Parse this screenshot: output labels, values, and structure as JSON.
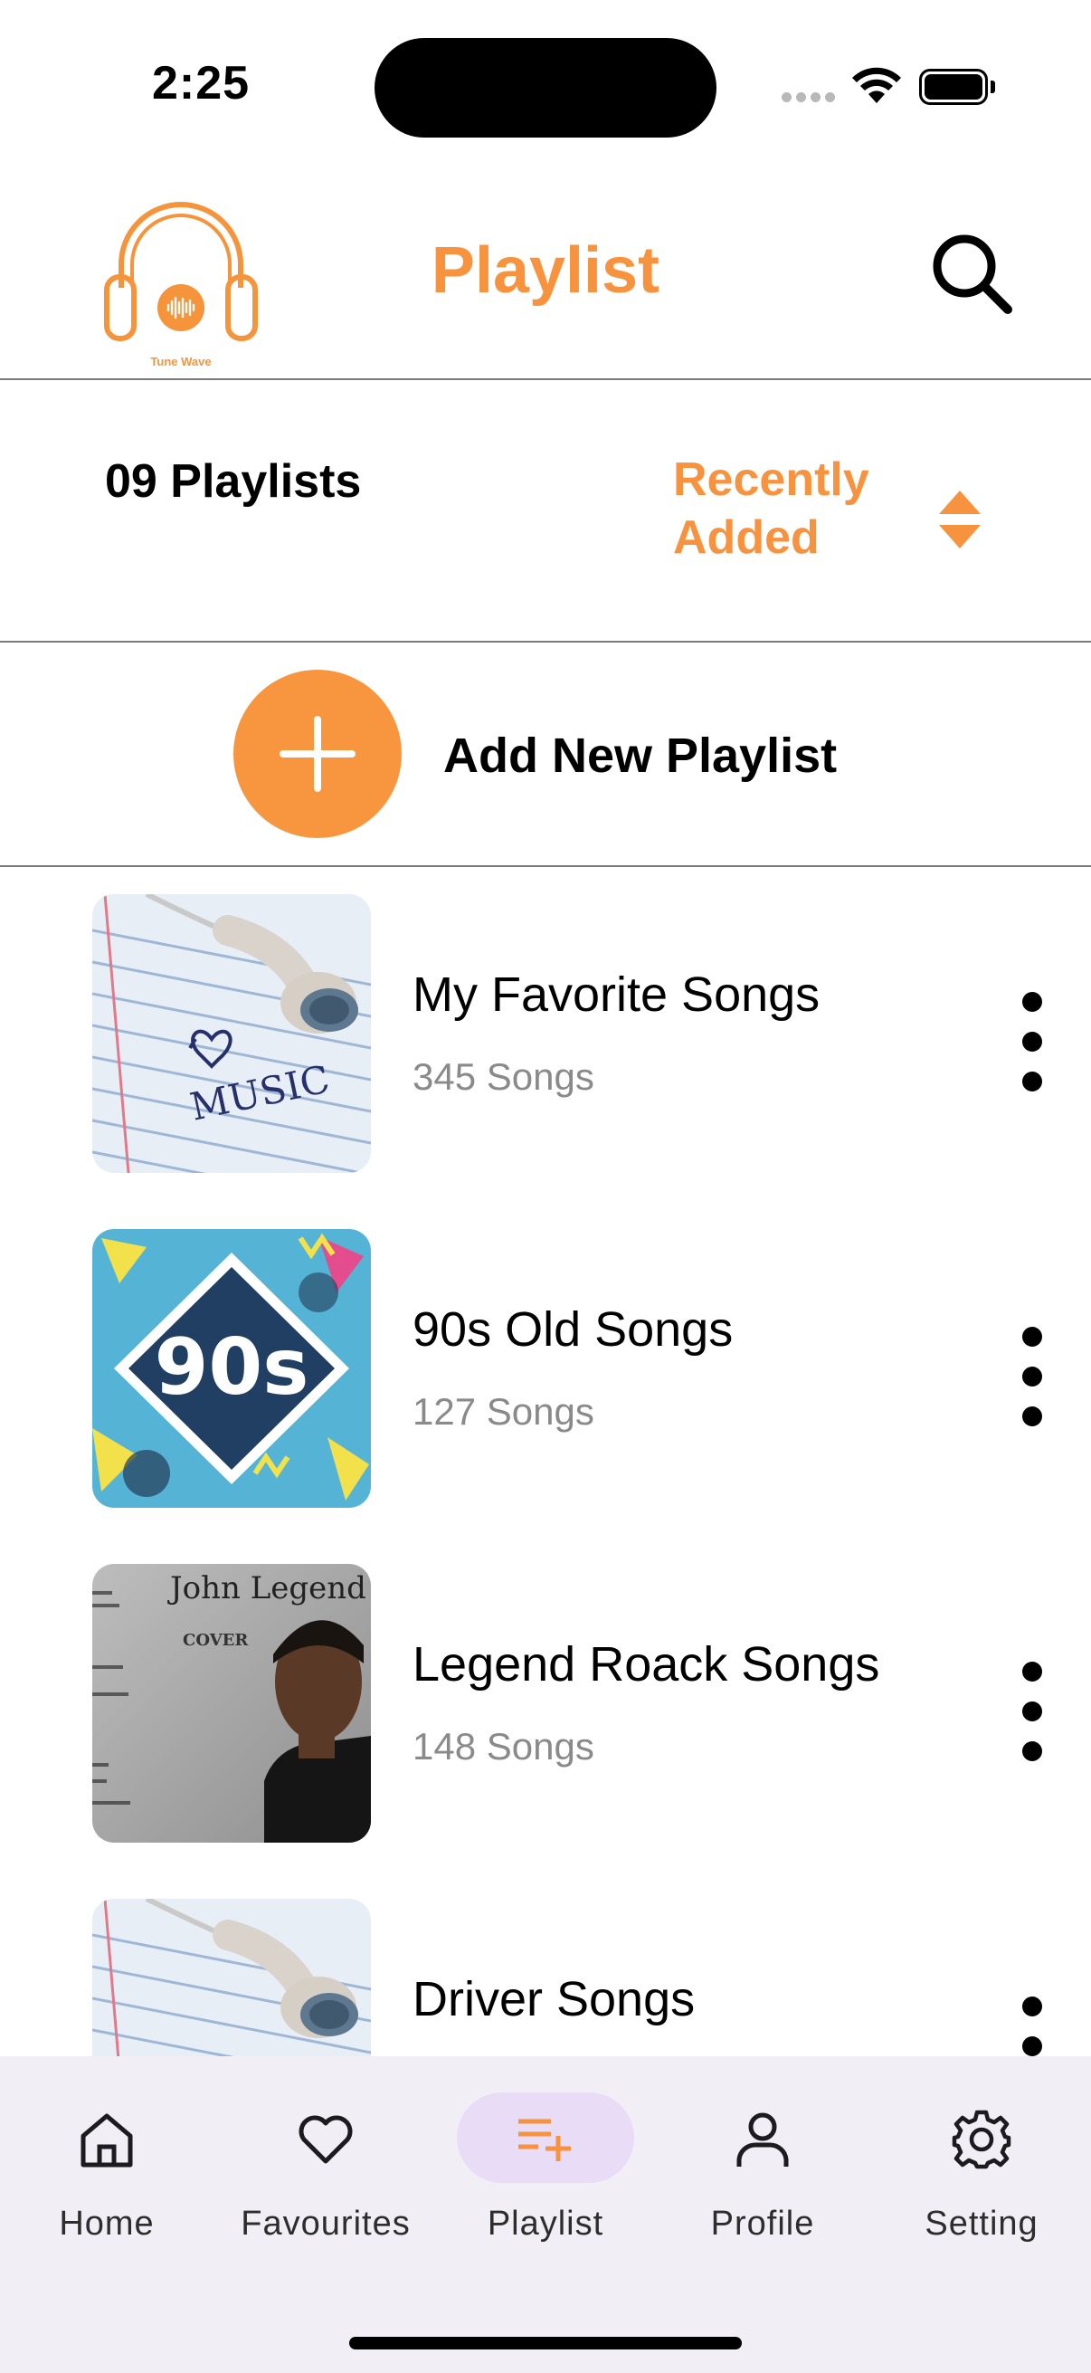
{
  "status_bar": {
    "time": "2:25"
  },
  "header": {
    "logo_text": "Tune Wave",
    "title": "Playlist",
    "search_icon": "search-icon"
  },
  "filter": {
    "count_label": "09 Playlists",
    "sort_label": "Recently Added",
    "sort_icon": "sort-updown-icon"
  },
  "add": {
    "label": "Add New Playlist",
    "icon": "plus-icon"
  },
  "playlists": [
    {
      "title": "My Favorite Songs",
      "count": "345 Songs",
      "art": "earbud-music"
    },
    {
      "title": "90s Old Songs",
      "count": "127 Songs",
      "art": "90s-pattern"
    },
    {
      "title": "Legend Roack Songs",
      "count": "148 Songs",
      "art": "john-legend-cover"
    },
    {
      "title": "Driver Songs",
      "count": "",
      "art": "earbud-music"
    }
  ],
  "art_text": {
    "music": "MUSIC",
    "nineties": "90s",
    "artist_name": "John Legend",
    "cover": "COVER"
  },
  "tabs": [
    {
      "label": "Home",
      "icon": "home-icon",
      "active": false
    },
    {
      "label": "Favourites",
      "icon": "heart-icon",
      "active": false
    },
    {
      "label": "Playlist",
      "icon": "playlist-add-icon",
      "active": true
    },
    {
      "label": "Profile",
      "icon": "person-icon",
      "active": false
    },
    {
      "label": "Setting",
      "icon": "gear-icon",
      "active": false
    }
  ],
  "colors": {
    "accent": "#f7933e",
    "tab_bar_bg": "#f2eef6",
    "active_tab_pill": "#e9dcf7",
    "secondary_text": "#8a8a8a"
  }
}
